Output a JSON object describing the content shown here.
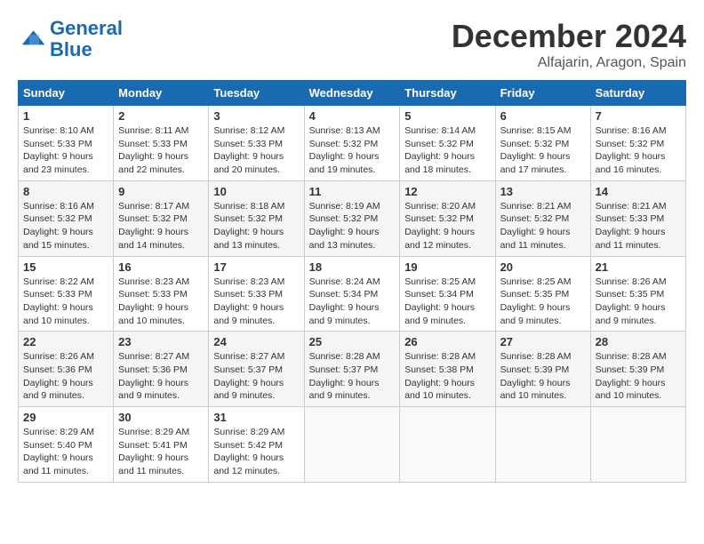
{
  "logo": {
    "line1": "General",
    "line2": "Blue"
  },
  "title": "December 2024",
  "location": "Alfajarin, Aragon, Spain",
  "days_of_week": [
    "Sunday",
    "Monday",
    "Tuesday",
    "Wednesday",
    "Thursday",
    "Friday",
    "Saturday"
  ],
  "weeks": [
    [
      {
        "day": "1",
        "sunrise": "8:10 AM",
        "sunset": "5:33 PM",
        "daylight": "9 hours and 23 minutes."
      },
      {
        "day": "2",
        "sunrise": "8:11 AM",
        "sunset": "5:33 PM",
        "daylight": "9 hours and 22 minutes."
      },
      {
        "day": "3",
        "sunrise": "8:12 AM",
        "sunset": "5:33 PM",
        "daylight": "9 hours and 20 minutes."
      },
      {
        "day": "4",
        "sunrise": "8:13 AM",
        "sunset": "5:32 PM",
        "daylight": "9 hours and 19 minutes."
      },
      {
        "day": "5",
        "sunrise": "8:14 AM",
        "sunset": "5:32 PM",
        "daylight": "9 hours and 18 minutes."
      },
      {
        "day": "6",
        "sunrise": "8:15 AM",
        "sunset": "5:32 PM",
        "daylight": "9 hours and 17 minutes."
      },
      {
        "day": "7",
        "sunrise": "8:16 AM",
        "sunset": "5:32 PM",
        "daylight": "9 hours and 16 minutes."
      }
    ],
    [
      {
        "day": "8",
        "sunrise": "8:16 AM",
        "sunset": "5:32 PM",
        "daylight": "9 hours and 15 minutes."
      },
      {
        "day": "9",
        "sunrise": "8:17 AM",
        "sunset": "5:32 PM",
        "daylight": "9 hours and 14 minutes."
      },
      {
        "day": "10",
        "sunrise": "8:18 AM",
        "sunset": "5:32 PM",
        "daylight": "9 hours and 13 minutes."
      },
      {
        "day": "11",
        "sunrise": "8:19 AM",
        "sunset": "5:32 PM",
        "daylight": "9 hours and 13 minutes."
      },
      {
        "day": "12",
        "sunrise": "8:20 AM",
        "sunset": "5:32 PM",
        "daylight": "9 hours and 12 minutes."
      },
      {
        "day": "13",
        "sunrise": "8:21 AM",
        "sunset": "5:32 PM",
        "daylight": "9 hours and 11 minutes."
      },
      {
        "day": "14",
        "sunrise": "8:21 AM",
        "sunset": "5:33 PM",
        "daylight": "9 hours and 11 minutes."
      }
    ],
    [
      {
        "day": "15",
        "sunrise": "8:22 AM",
        "sunset": "5:33 PM",
        "daylight": "9 hours and 10 minutes."
      },
      {
        "day": "16",
        "sunrise": "8:23 AM",
        "sunset": "5:33 PM",
        "daylight": "9 hours and 10 minutes."
      },
      {
        "day": "17",
        "sunrise": "8:23 AM",
        "sunset": "5:33 PM",
        "daylight": "9 hours and 9 minutes."
      },
      {
        "day": "18",
        "sunrise": "8:24 AM",
        "sunset": "5:34 PM",
        "daylight": "9 hours and 9 minutes."
      },
      {
        "day": "19",
        "sunrise": "8:25 AM",
        "sunset": "5:34 PM",
        "daylight": "9 hours and 9 minutes."
      },
      {
        "day": "20",
        "sunrise": "8:25 AM",
        "sunset": "5:35 PM",
        "daylight": "9 hours and 9 minutes."
      },
      {
        "day": "21",
        "sunrise": "8:26 AM",
        "sunset": "5:35 PM",
        "daylight": "9 hours and 9 minutes."
      }
    ],
    [
      {
        "day": "22",
        "sunrise": "8:26 AM",
        "sunset": "5:36 PM",
        "daylight": "9 hours and 9 minutes."
      },
      {
        "day": "23",
        "sunrise": "8:27 AM",
        "sunset": "5:36 PM",
        "daylight": "9 hours and 9 minutes."
      },
      {
        "day": "24",
        "sunrise": "8:27 AM",
        "sunset": "5:37 PM",
        "daylight": "9 hours and 9 minutes."
      },
      {
        "day": "25",
        "sunrise": "8:28 AM",
        "sunset": "5:37 PM",
        "daylight": "9 hours and 9 minutes."
      },
      {
        "day": "26",
        "sunrise": "8:28 AM",
        "sunset": "5:38 PM",
        "daylight": "9 hours and 10 minutes."
      },
      {
        "day": "27",
        "sunrise": "8:28 AM",
        "sunset": "5:39 PM",
        "daylight": "9 hours and 10 minutes."
      },
      {
        "day": "28",
        "sunrise": "8:28 AM",
        "sunset": "5:39 PM",
        "daylight": "9 hours and 10 minutes."
      }
    ],
    [
      {
        "day": "29",
        "sunrise": "8:29 AM",
        "sunset": "5:40 PM",
        "daylight": "9 hours and 11 minutes."
      },
      {
        "day": "30",
        "sunrise": "8:29 AM",
        "sunset": "5:41 PM",
        "daylight": "9 hours and 11 minutes."
      },
      {
        "day": "31",
        "sunrise": "8:29 AM",
        "sunset": "5:42 PM",
        "daylight": "9 hours and 12 minutes."
      },
      null,
      null,
      null,
      null
    ]
  ]
}
